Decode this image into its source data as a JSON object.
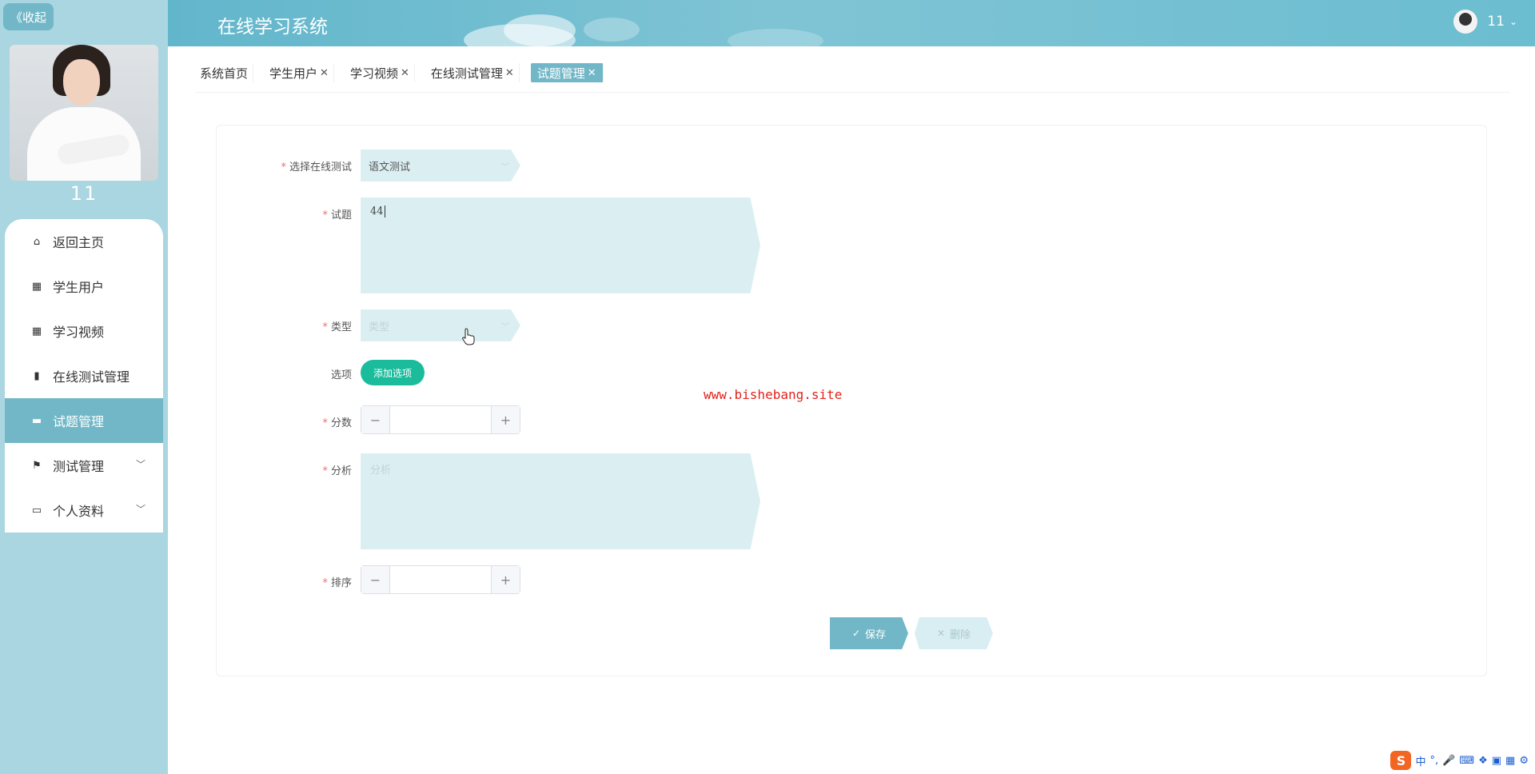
{
  "sidebar": {
    "collapse_label": "《收起",
    "username": "11",
    "menu": [
      {
        "label": "返回主页",
        "icon": "home-icon",
        "has_children": false,
        "active": false
      },
      {
        "label": "学生用户",
        "icon": "grid-icon",
        "has_children": false,
        "active": false
      },
      {
        "label": "学习视频",
        "icon": "grid-icon",
        "has_children": false,
        "active": false
      },
      {
        "label": "在线测试管理",
        "icon": "book-icon",
        "has_children": false,
        "active": false
      },
      {
        "label": "试题管理",
        "icon": "monitor-icon",
        "has_children": false,
        "active": true
      },
      {
        "label": "测试管理",
        "icon": "flag-icon",
        "has_children": true,
        "active": false
      },
      {
        "label": "个人资料",
        "icon": "card-icon",
        "has_children": true,
        "active": false
      }
    ]
  },
  "header": {
    "title": "在线学习系统",
    "user_name": "11"
  },
  "tabs": [
    {
      "label": "系统首页",
      "closable": false,
      "active": false
    },
    {
      "label": "学生用户",
      "closable": true,
      "active": false
    },
    {
      "label": "学习视频",
      "closable": true,
      "active": false
    },
    {
      "label": "在线测试管理",
      "closable": true,
      "active": false
    },
    {
      "label": "试题管理",
      "closable": true,
      "active": true
    }
  ],
  "form": {
    "test_select": {
      "label": "选择在线测试",
      "required": true,
      "value": "语文测试"
    },
    "question": {
      "label": "试题",
      "required": true,
      "value": "44"
    },
    "type": {
      "label": "类型",
      "required": true,
      "placeholder": "类型",
      "value": ""
    },
    "options": {
      "label": "选项",
      "required": false,
      "add_button": "添加选项"
    },
    "score": {
      "label": "分数",
      "required": true,
      "value": ""
    },
    "analysis": {
      "label": "分析",
      "required": true,
      "placeholder": "分析",
      "value": ""
    },
    "order": {
      "label": "排序",
      "required": true,
      "value": ""
    },
    "save_label": "保存",
    "delete_label": "删除"
  },
  "watermark": "www.bishebang.site",
  "ime": {
    "lang": "中",
    "punct": "°,"
  },
  "colors": {
    "sidebar_bg": "#a9d6e0",
    "accent": "#72b7c7",
    "green_button": "#1abc9c",
    "input_bg": "#dbeff3",
    "required_star": "#f56c6c",
    "watermark": "#e2231a"
  }
}
